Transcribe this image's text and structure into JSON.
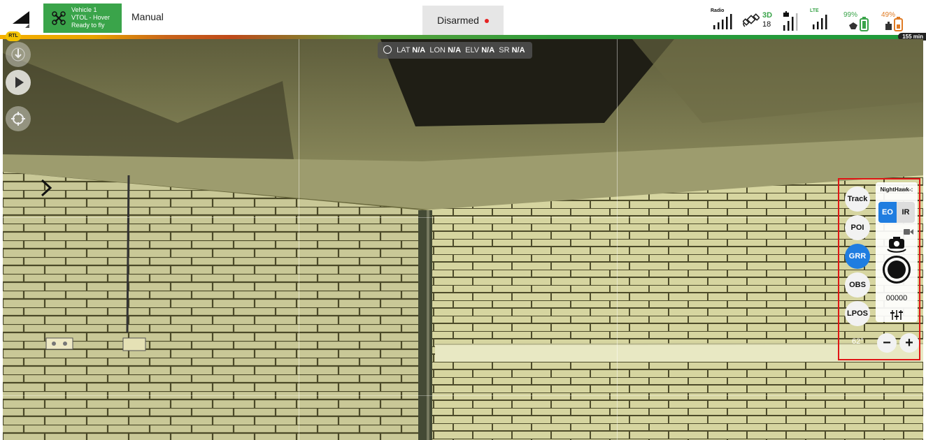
{
  "vehicle": {
    "name": "Vehicle 1",
    "type": "VTOL - Hover",
    "status": "Ready to fly"
  },
  "flight_mode": "Manual",
  "arm_status": "Disarmed",
  "telemetry": {
    "radio_label": "Radio",
    "gps_fix": "3D",
    "gps_sats": "18",
    "lte_label": "LTE",
    "remote_battery": "99%",
    "drone_battery": "49%"
  },
  "remaining_time": "155 min",
  "rtl_label": "RTL",
  "gps_bar": {
    "lat_label": "LAT",
    "lat": "N/A",
    "lon_label": "LON",
    "lon": "N/A",
    "elv_label": "ELV",
    "elv": "N/A",
    "sr_label": "SR",
    "sr": "N/A"
  },
  "gimbal": {
    "buttons": [
      {
        "label": "Track"
      },
      {
        "label": "POI"
      },
      {
        "label": "GRR",
        "active": true
      },
      {
        "label": "OBS"
      },
      {
        "label": "LPOS"
      }
    ],
    "camera_name": "NightHawk-:",
    "eo_label": "EO",
    "ir_label": "IR",
    "counter": "00000",
    "fov": "62°"
  },
  "colors": {
    "vehicle_green": "#3aa44a",
    "accent_blue": "#1f7de0",
    "highlight_red": "#e01616",
    "rtl_yellow": "#f3c200"
  }
}
